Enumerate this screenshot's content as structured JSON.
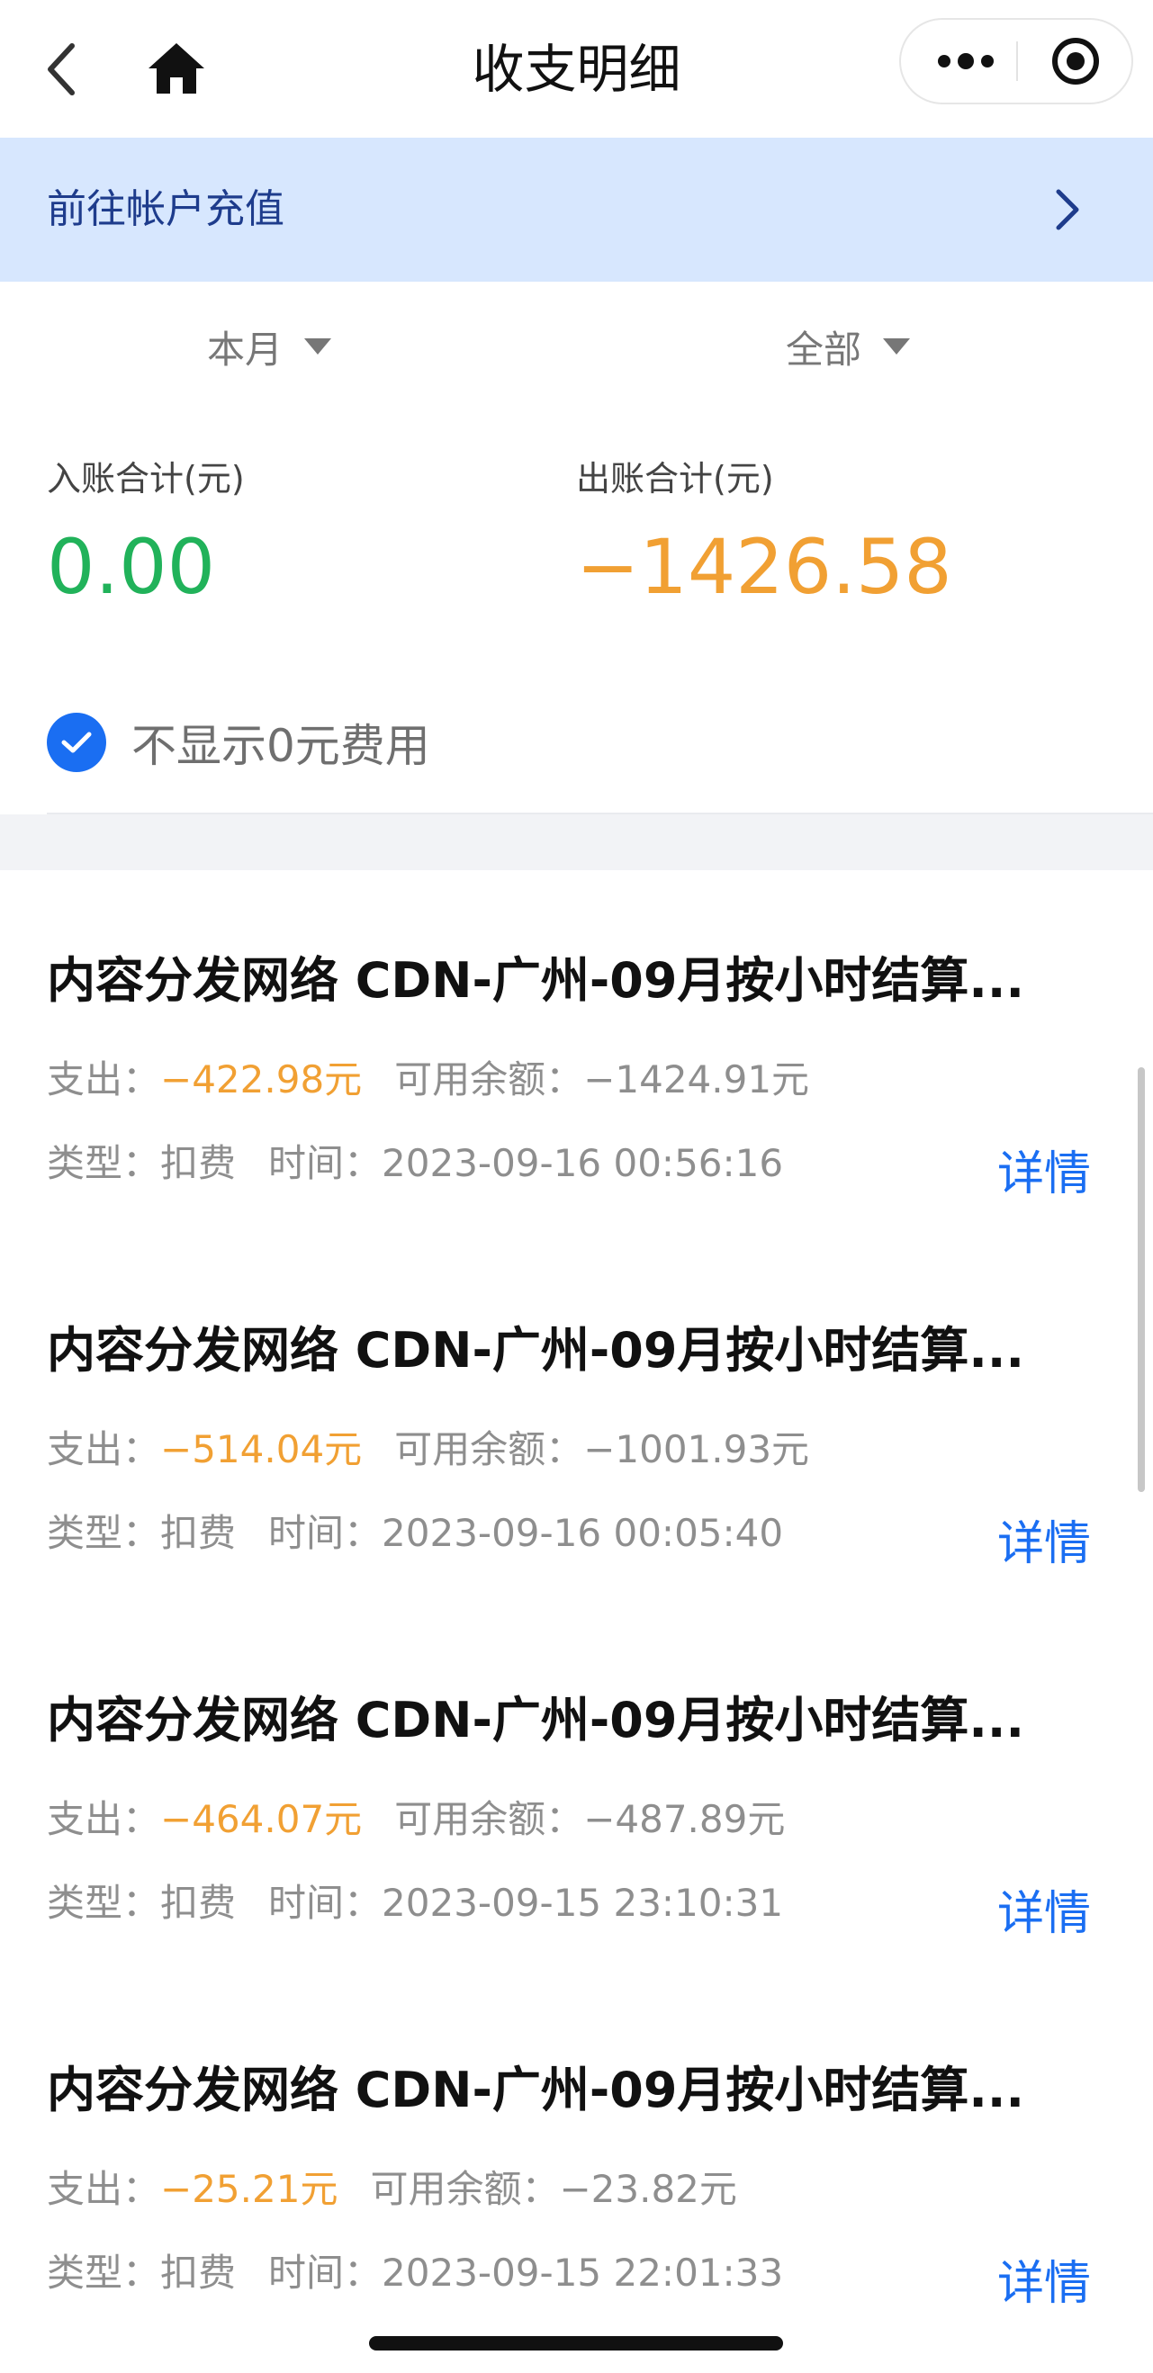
{
  "header": {
    "title": "收支明细"
  },
  "recharge": {
    "label": "前往帐户充值"
  },
  "filters": {
    "period": "本月",
    "type": "全部"
  },
  "totals": {
    "income_label": "入账合计(元)",
    "income_value": "0.00",
    "expense_label": "出账合计(元)",
    "expense_value": "−1426.58"
  },
  "hide_zero": {
    "label": "不显示0元费用",
    "checked": true
  },
  "records": [
    {
      "title": "内容分发网络 CDN-广州-09月按小时结算...",
      "expense_label": "支出：",
      "amount": "−422.98元",
      "balance_label": "可用余额：",
      "balance": "−1424.91元",
      "type_label": "类型：",
      "type": "扣费",
      "time_label": "时间：",
      "time": "2023-09-16 00:56:16",
      "detail": "详情"
    },
    {
      "title": "内容分发网络 CDN-广州-09月按小时结算...",
      "expense_label": "支出：",
      "amount": "−514.04元",
      "balance_label": "可用余额：",
      "balance": "−1001.93元",
      "type_label": "类型：",
      "type": "扣费",
      "time_label": "时间：",
      "time": "2023-09-16 00:05:40",
      "detail": "详情"
    },
    {
      "title": "内容分发网络 CDN-广州-09月按小时结算...",
      "expense_label": "支出：",
      "amount": "−464.07元",
      "balance_label": "可用余额：",
      "balance": "−487.89元",
      "type_label": "类型：",
      "type": "扣费",
      "time_label": "时间：",
      "time": "2023-09-15 23:10:31",
      "detail": "详情"
    },
    {
      "title": "内容分发网络 CDN-广州-09月按小时结算...",
      "expense_label": "支出：",
      "amount": "−25.21元",
      "balance_label": "可用余额：",
      "balance": "−23.82元",
      "type_label": "类型：",
      "type": "扣费",
      "time_label": "时间：",
      "time": "2023-09-15 22:01:33",
      "detail": "详情"
    }
  ],
  "colors": {
    "income": "#21b25a",
    "expense": "#f1a033",
    "link": "#1a6ef2",
    "banner_bg": "#d7e7fe"
  },
  "icons": {
    "back": "back-chevron-icon",
    "home": "home-icon",
    "more": "more-dots-icon",
    "close": "target-close-icon",
    "banner_arrow": "chevron-right-icon",
    "checkbox": "check-icon"
  }
}
